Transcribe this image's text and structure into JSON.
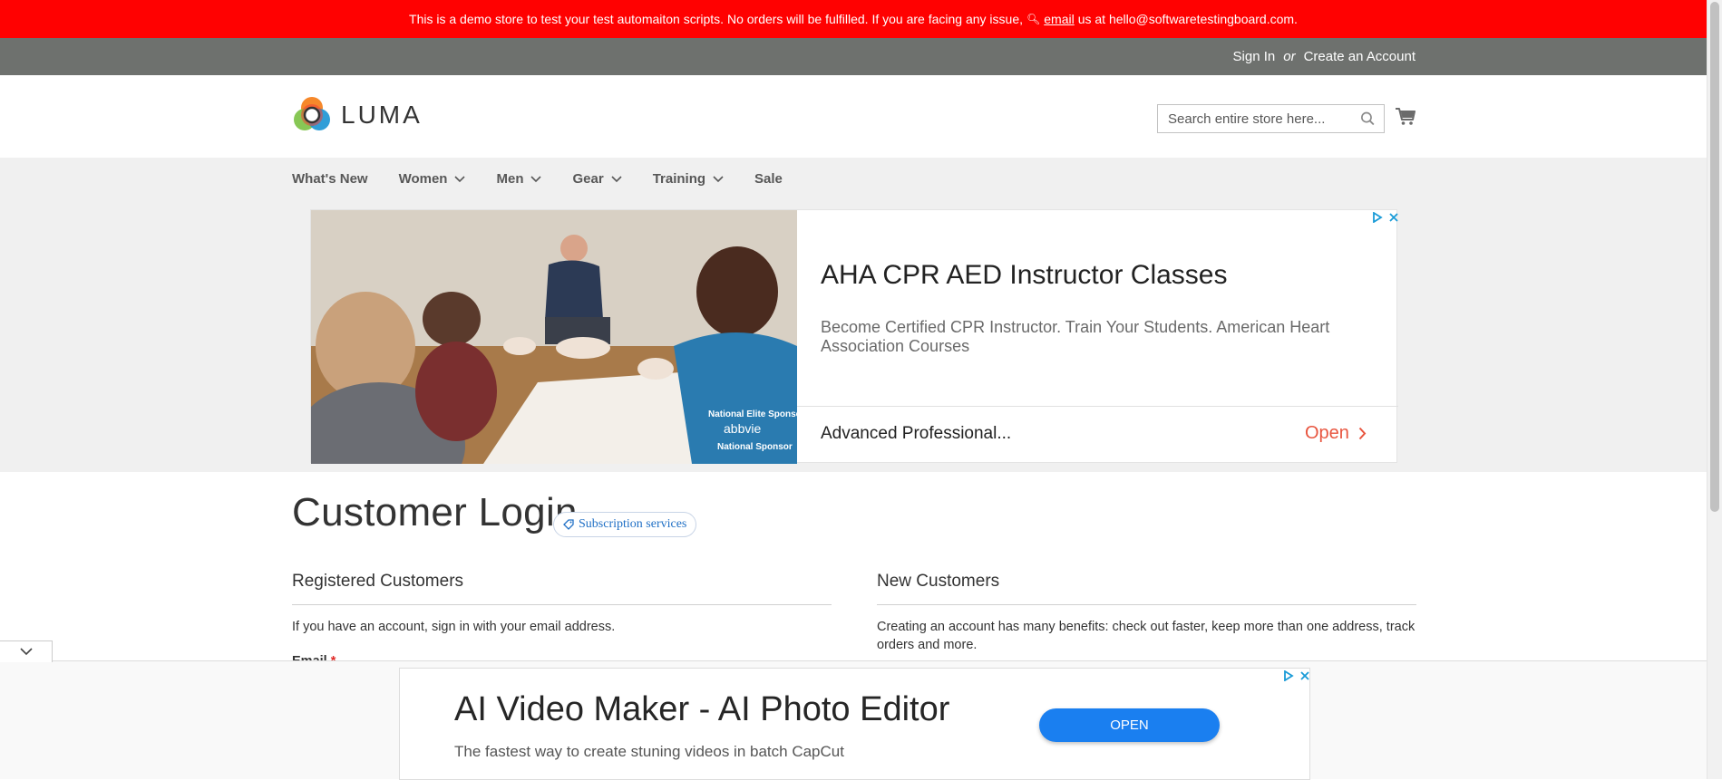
{
  "demo_banner": {
    "text_before": "This is a demo store to test your test automaiton scripts. No orders will be fulfilled. If you are facing any issue,",
    "email_link": "email",
    "text_after": "us at hello@softwaretestingboard.com."
  },
  "top_links": {
    "sign_in": "Sign In",
    "or": "or",
    "create_account": "Create an Account"
  },
  "header": {
    "logo_text": "LUMA",
    "search_placeholder": "Search entire store here..."
  },
  "nav": {
    "items": [
      {
        "label": "What's New",
        "has_dropdown": false
      },
      {
        "label": "Women",
        "has_dropdown": true
      },
      {
        "label": "Men",
        "has_dropdown": true
      },
      {
        "label": "Gear",
        "has_dropdown": true
      },
      {
        "label": "Training",
        "has_dropdown": true
      },
      {
        "label": "Sale",
        "has_dropdown": false
      }
    ]
  },
  "ad_top": {
    "title": "AHA CPR AED Instructor Classes",
    "description": "Become Certified CPR Instructor. Train Your Students. American Heart Association Courses",
    "subline": "Advanced Professional...",
    "cta": "Open",
    "photo_text_1": "National Elite Sponsor",
    "photo_text_2": "abbvie",
    "photo_text_3": "National Sponsor"
  },
  "main": {
    "page_title": "Customer Login",
    "subscription_badge": "Subscription services",
    "registered": {
      "title": "Registered Customers",
      "text": "If you have an account, sign in with your email address.",
      "email_label": "Email",
      "required_mark": "*"
    },
    "new_customers": {
      "title": "New Customers",
      "text": "Creating an account has many benefits: check out faster, keep more than one address, track orders and more."
    }
  },
  "ad_bottom": {
    "title": "AI Video Maker - AI Photo Editor",
    "description": "The fastest way to create stuning videos in batch CapCut",
    "cta": "OPEN"
  },
  "colors": {
    "banner_red": "#ff0101",
    "top_bar_gray": "#6e716e",
    "nav_bg": "#f0f0f0",
    "ad_cta_orange": "#e8553f",
    "ad_btn_blue": "#1a7ff0",
    "required_red": "#e02b27"
  }
}
